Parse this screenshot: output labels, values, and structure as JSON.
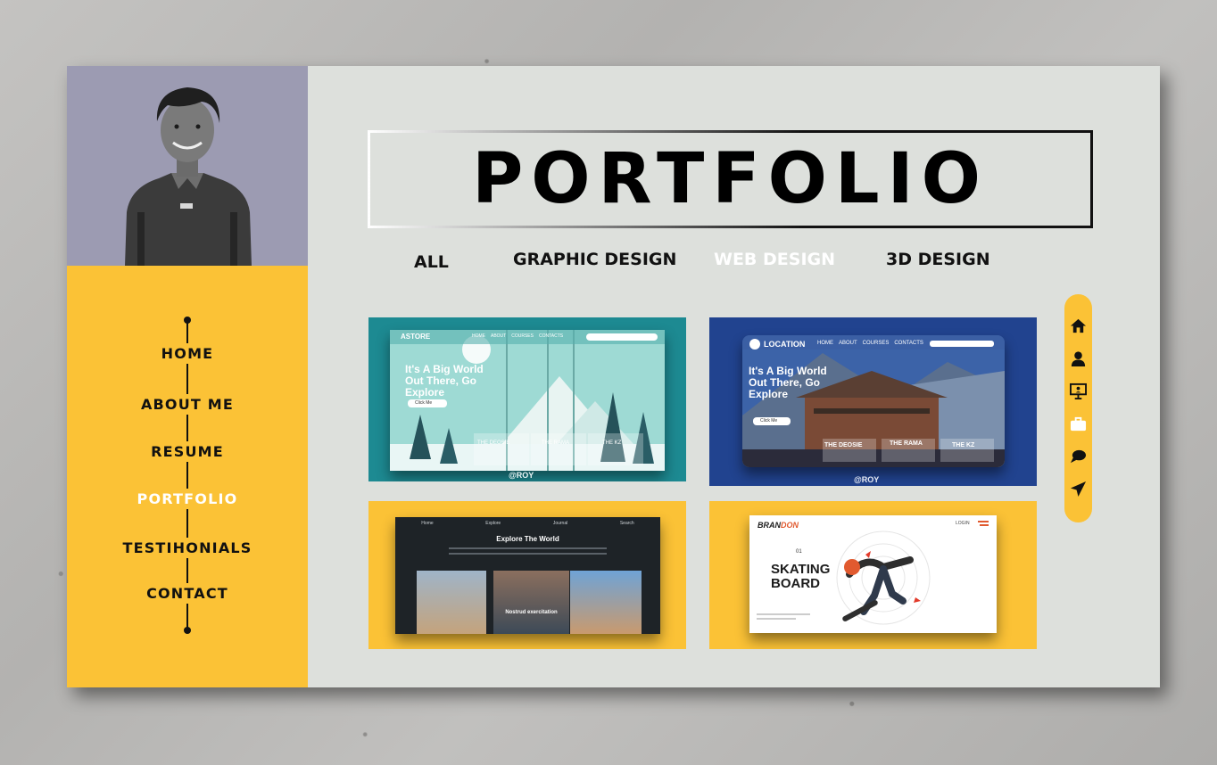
{
  "sidebar": {
    "nav": [
      {
        "label": "HOME"
      },
      {
        "label": "ABOUT ME"
      },
      {
        "label": "RESUME"
      },
      {
        "label": "PORTFOLIO"
      },
      {
        "label": "TESTIHONIALS"
      },
      {
        "label": "CONTACT"
      }
    ],
    "active_item": "PORTFOLIO"
  },
  "header": {
    "title": "PORTFOLIO"
  },
  "filters": [
    {
      "label": "ALL"
    },
    {
      "label": "GRAPHIC DESIGN"
    },
    {
      "label": "WEB DESIGN"
    },
    {
      "label": "3D DESIGN"
    }
  ],
  "active_filter": "WEB DESIGN",
  "projects": {
    "astore": {
      "logo": "ASTORE",
      "nav": [
        "HOME",
        "ABOUT",
        "COURSES",
        "CONTACTS"
      ],
      "headline": "It's A Big World Out There, Go Explore",
      "button": "Click Me",
      "tiles": [
        "THE DEOSIE",
        "THE RAMA",
        "THE KZ"
      ],
      "credit": "@ROY"
    },
    "location": {
      "logo": "LOCATION",
      "nav": [
        "HOME",
        "ABOUT",
        "COURSES",
        "CONTACTS"
      ],
      "headline": "It's A Big World Out There, Go Explore",
      "button": "Click Me",
      "tiles": [
        "THE DEOSIE",
        "THE RAMA",
        "THE KZ"
      ],
      "credit": "@ROY"
    },
    "explore": {
      "nav": [
        "Home",
        "Explore",
        "Journal",
        "Search"
      ],
      "headline": "Explore The World",
      "caption": "Nostrud exercitation"
    },
    "skating": {
      "brand_a": "BRAN",
      "brand_b": "DON",
      "number": "01",
      "line1": "SKATING",
      "line2": "BOARD",
      "corner": "LOGIN"
    }
  },
  "dock_icons": [
    "home-icon",
    "user-icon",
    "presentation-icon",
    "briefcase-icon",
    "chat-icon",
    "send-icon"
  ],
  "colors": {
    "accent_yellow": "#fbc236",
    "photo_bg": "#9c9bb2",
    "board_bg": "#dde0dc",
    "teal": "#1d8a92",
    "navy": "#21438f"
  }
}
